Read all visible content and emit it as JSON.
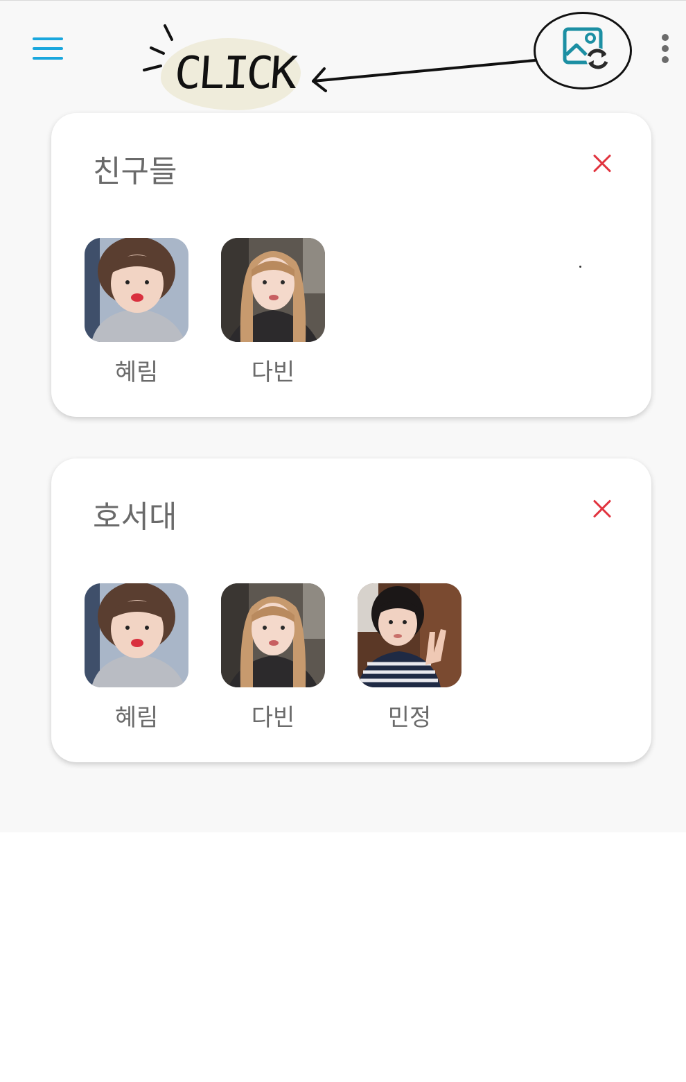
{
  "toolbar": {
    "annotation_text": "CLICK",
    "menu_icon": "hamburger-menu-icon",
    "gallery_icon": "image-swap-icon",
    "more_icon": "more-vertical-icon",
    "accent_color": "#1aa7dd",
    "gallery_icon_color": "#1c8fa3"
  },
  "groups": [
    {
      "title": "친구들",
      "close_icon": "close-icon",
      "close_color": "#e1343f",
      "members": [
        {
          "name": "혜림"
        },
        {
          "name": "다빈"
        }
      ]
    },
    {
      "title": "호서대",
      "close_icon": "close-icon",
      "close_color": "#e1343f",
      "members": [
        {
          "name": "혜림"
        },
        {
          "name": "다빈"
        },
        {
          "name": "민정"
        }
      ]
    }
  ]
}
